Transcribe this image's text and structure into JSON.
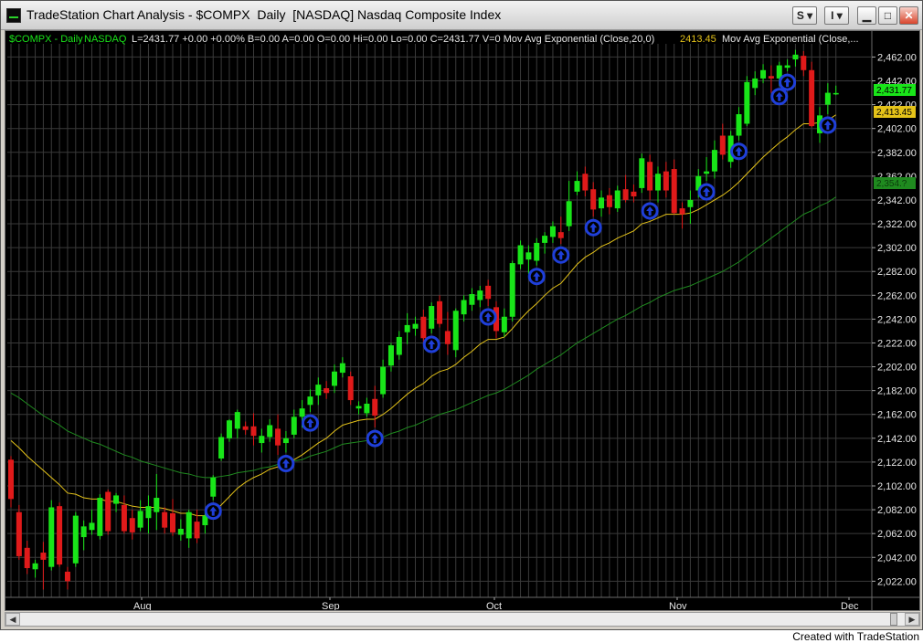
{
  "window": {
    "title": "TradeStation Chart Analysis - $COMPX  Daily  [NASDAQ] Nasdaq Composite Index",
    "buttons": {
      "s_label": "S ▾",
      "i_label": "I ▾",
      "minimize": "▁",
      "maximize": "□",
      "close": "✕"
    }
  },
  "status": {
    "symbol": "$COMPX - Daily",
    "exchange": "NASDAQ",
    "values": "L=2431.77  +0.00  +0.00%  B=0.00  A=0.00  O=0.00  Hi=0.00  Lo=0.00  C=2431.77  V=0  Mov Avg Exponential  (Close,20,0)",
    "ema20_value": "2413.45",
    "ema2_label": "Mov Avg Exponential  (Close,..."
  },
  "price_badges": {
    "last": "2,431.77",
    "ema20": "2,413.45",
    "ema50": "2,354.?"
  },
  "colors": {
    "up": "#19e519",
    "down": "#e01a1a",
    "ema20": "#e5c319",
    "ema50": "#1f8a1f",
    "signal": "#1f3fd9",
    "grid": "#3a3a3a",
    "background": "#000000"
  },
  "credit": "Created with TradeStation",
  "chart_data": {
    "type": "candlestick",
    "title": "$COMPX - Daily",
    "y_axis": {
      "min": 2010,
      "max": 2470,
      "ticks": [
        "2,022.00",
        "2,042.00",
        "2,062.00",
        "2,082.00",
        "2,102.00",
        "2,122.00",
        "2,142.00",
        "2,162.00",
        "2,182.00",
        "2,202.00",
        "2,222.00",
        "2,242.00",
        "2,262.00",
        "2,282.00",
        "2,302.00",
        "2,322.00",
        "2,342.00",
        "2,362.00",
        "2,382.00",
        "2,402.00",
        "2,422.00",
        "2,442.00",
        "2,462.00"
      ]
    },
    "x_axis": {
      "labels": [
        "Aug",
        "Sep",
        "Oct",
        "Nov",
        "Dec"
      ]
    },
    "candles": [
      {
        "o": 2124,
        "h": 2127,
        "l": 2084,
        "c": 2091
      },
      {
        "o": 2080,
        "h": 2086,
        "l": 2040,
        "c": 2043
      },
      {
        "o": 2050,
        "h": 2056,
        "l": 2028,
        "c": 2033
      },
      {
        "o": 2032,
        "h": 2040,
        "l": 2025,
        "c": 2037
      },
      {
        "o": 2046,
        "h": 2055,
        "l": 2015,
        "c": 2040
      },
      {
        "o": 2034,
        "h": 2090,
        "l": 2031,
        "c": 2084
      },
      {
        "o": 2085,
        "h": 2088,
        "l": 2034,
        "c": 2036
      },
      {
        "o": 2030,
        "h": 2034,
        "l": 2015,
        "c": 2022
      },
      {
        "o": 2037,
        "h": 2080,
        "l": 2034,
        "c": 2077
      },
      {
        "o": 2059,
        "h": 2073,
        "l": 2048,
        "c": 2068
      },
      {
        "o": 2065,
        "h": 2082,
        "l": 2061,
        "c": 2071
      },
      {
        "o": 2060,
        "h": 2095,
        "l": 2057,
        "c": 2092
      },
      {
        "o": 2097,
        "h": 2099,
        "l": 2061,
        "c": 2064
      },
      {
        "o": 2087,
        "h": 2096,
        "l": 2080,
        "c": 2094
      },
      {
        "o": 2086,
        "h": 2094,
        "l": 2062,
        "c": 2064
      },
      {
        "o": 2075,
        "h": 2082,
        "l": 2057,
        "c": 2063
      },
      {
        "o": 2067,
        "h": 2090,
        "l": 2064,
        "c": 2081
      },
      {
        "o": 2075,
        "h": 2094,
        "l": 2062,
        "c": 2085
      },
      {
        "o": 2080,
        "h": 2112,
        "l": 2065,
        "c": 2092
      },
      {
        "o": 2080,
        "h": 2084,
        "l": 2062,
        "c": 2067
      },
      {
        "o": 2079,
        "h": 2091,
        "l": 2060,
        "c": 2063
      },
      {
        "o": 2061,
        "h": 2074,
        "l": 2056,
        "c": 2066
      },
      {
        "o": 2058,
        "h": 2082,
        "l": 2050,
        "c": 2080
      },
      {
        "o": 2072,
        "h": 2082,
        "l": 2054,
        "c": 2058
      },
      {
        "o": 2069,
        "h": 2081,
        "l": 2062,
        "c": 2077
      },
      {
        "o": 2093,
        "h": 2111,
        "l": 2090,
        "c": 2109
      },
      {
        "o": 2125,
        "h": 2146,
        "l": 2123,
        "c": 2143
      },
      {
        "o": 2142,
        "h": 2158,
        "l": 2139,
        "c": 2157
      },
      {
        "o": 2150,
        "h": 2166,
        "l": 2142,
        "c": 2164
      },
      {
        "o": 2152,
        "h": 2156,
        "l": 2145,
        "c": 2149
      },
      {
        "o": 2152,
        "h": 2163,
        "l": 2136,
        "c": 2144
      },
      {
        "o": 2138,
        "h": 2150,
        "l": 2130,
        "c": 2144
      },
      {
        "o": 2143,
        "h": 2158,
        "l": 2139,
        "c": 2153
      },
      {
        "o": 2150,
        "h": 2162,
        "l": 2128,
        "c": 2136
      },
      {
        "o": 2138,
        "h": 2148,
        "l": 2130,
        "c": 2142
      },
      {
        "o": 2145,
        "h": 2166,
        "l": 2142,
        "c": 2160
      },
      {
        "o": 2160,
        "h": 2174,
        "l": 2151,
        "c": 2167
      },
      {
        "o": 2170,
        "h": 2183,
        "l": 2164,
        "c": 2177
      },
      {
        "o": 2178,
        "h": 2193,
        "l": 2170,
        "c": 2187
      },
      {
        "o": 2184,
        "h": 2190,
        "l": 2175,
        "c": 2180
      },
      {
        "o": 2186,
        "h": 2204,
        "l": 2180,
        "c": 2198
      },
      {
        "o": 2197,
        "h": 2210,
        "l": 2193,
        "c": 2205
      },
      {
        "o": 2194,
        "h": 2198,
        "l": 2170,
        "c": 2174
      },
      {
        "o": 2167,
        "h": 2173,
        "l": 2162,
        "c": 2169
      },
      {
        "o": 2163,
        "h": 2176,
        "l": 2160,
        "c": 2171
      },
      {
        "o": 2175,
        "h": 2186,
        "l": 2151,
        "c": 2161
      },
      {
        "o": 2179,
        "h": 2208,
        "l": 2176,
        "c": 2202
      },
      {
        "o": 2203,
        "h": 2222,
        "l": 2198,
        "c": 2220
      },
      {
        "o": 2212,
        "h": 2232,
        "l": 2208,
        "c": 2227
      },
      {
        "o": 2231,
        "h": 2247,
        "l": 2221,
        "c": 2237
      },
      {
        "o": 2234,
        "h": 2244,
        "l": 2228,
        "c": 2238
      },
      {
        "o": 2244,
        "h": 2250,
        "l": 2222,
        "c": 2226
      },
      {
        "o": 2234,
        "h": 2256,
        "l": 2230,
        "c": 2253
      },
      {
        "o": 2257,
        "h": 2262,
        "l": 2235,
        "c": 2238
      },
      {
        "o": 2232,
        "h": 2248,
        "l": 2212,
        "c": 2221
      },
      {
        "o": 2216,
        "h": 2251,
        "l": 2210,
        "c": 2249
      },
      {
        "o": 2246,
        "h": 2262,
        "l": 2240,
        "c": 2258
      },
      {
        "o": 2254,
        "h": 2268,
        "l": 2249,
        "c": 2263
      },
      {
        "o": 2258,
        "h": 2270,
        "l": 2252,
        "c": 2266
      },
      {
        "o": 2270,
        "h": 2275,
        "l": 2253,
        "c": 2259
      },
      {
        "o": 2252,
        "h": 2257,
        "l": 2226,
        "c": 2232
      },
      {
        "o": 2231,
        "h": 2251,
        "l": 2227,
        "c": 2244
      },
      {
        "o": 2244,
        "h": 2291,
        "l": 2240,
        "c": 2289
      },
      {
        "o": 2288,
        "h": 2308,
        "l": 2284,
        "c": 2304
      },
      {
        "o": 2292,
        "h": 2304,
        "l": 2280,
        "c": 2298
      },
      {
        "o": 2291,
        "h": 2310,
        "l": 2287,
        "c": 2306
      },
      {
        "o": 2306,
        "h": 2315,
        "l": 2297,
        "c": 2312
      },
      {
        "o": 2311,
        "h": 2324,
        "l": 2306,
        "c": 2320
      },
      {
        "o": 2315,
        "h": 2328,
        "l": 2305,
        "c": 2310
      },
      {
        "o": 2320,
        "h": 2358,
        "l": 2316,
        "c": 2341
      },
      {
        "o": 2349,
        "h": 2366,
        "l": 2346,
        "c": 2358
      },
      {
        "o": 2364,
        "h": 2370,
        "l": 2345,
        "c": 2350
      },
      {
        "o": 2351,
        "h": 2357,
        "l": 2328,
        "c": 2334
      },
      {
        "o": 2335,
        "h": 2350,
        "l": 2328,
        "c": 2344
      },
      {
        "o": 2346,
        "h": 2352,
        "l": 2330,
        "c": 2336
      },
      {
        "o": 2335,
        "h": 2354,
        "l": 2332,
        "c": 2350
      },
      {
        "o": 2351,
        "h": 2363,
        "l": 2340,
        "c": 2342
      },
      {
        "o": 2349,
        "h": 2355,
        "l": 2340,
        "c": 2345
      },
      {
        "o": 2352,
        "h": 2381,
        "l": 2348,
        "c": 2377
      },
      {
        "o": 2374,
        "h": 2380,
        "l": 2342,
        "c": 2350
      },
      {
        "o": 2350,
        "h": 2370,
        "l": 2340,
        "c": 2364
      },
      {
        "o": 2366,
        "h": 2374,
        "l": 2344,
        "c": 2350
      },
      {
        "o": 2368,
        "h": 2376,
        "l": 2330,
        "c": 2331
      },
      {
        "o": 2335,
        "h": 2340,
        "l": 2318,
        "c": 2330
      },
      {
        "o": 2336,
        "h": 2350,
        "l": 2322,
        "c": 2342
      },
      {
        "o": 2350,
        "h": 2368,
        "l": 2344,
        "c": 2362
      },
      {
        "o": 2364,
        "h": 2378,
        "l": 2358,
        "c": 2366
      },
      {
        "o": 2366,
        "h": 2392,
        "l": 2360,
        "c": 2384
      },
      {
        "o": 2396,
        "h": 2406,
        "l": 2376,
        "c": 2380
      },
      {
        "o": 2374,
        "h": 2400,
        "l": 2369,
        "c": 2396
      },
      {
        "o": 2396,
        "h": 2420,
        "l": 2392,
        "c": 2414
      },
      {
        "o": 2406,
        "h": 2446,
        "l": 2404,
        "c": 2441
      },
      {
        "o": 2436,
        "h": 2450,
        "l": 2430,
        "c": 2444
      },
      {
        "o": 2444,
        "h": 2456,
        "l": 2440,
        "c": 2451
      },
      {
        "o": 2446,
        "h": 2455,
        "l": 2432,
        "c": 2444
      },
      {
        "o": 2444,
        "h": 2458,
        "l": 2438,
        "c": 2455
      },
      {
        "o": 2453,
        "h": 2460,
        "l": 2450,
        "c": 2455
      },
      {
        "o": 2460,
        "h": 2468,
        "l": 2454,
        "c": 2464
      },
      {
        "o": 2463,
        "h": 2467,
        "l": 2446,
        "c": 2451
      },
      {
        "o": 2451,
        "h": 2458,
        "l": 2403,
        "c": 2404
      },
      {
        "o": 2398,
        "h": 2420,
        "l": 2390,
        "c": 2413
      },
      {
        "o": 2422,
        "h": 2440,
        "l": 2414,
        "c": 2432
      },
      {
        "o": 2431.77,
        "h": 2438,
        "l": 2430,
        "c": 2431.77
      }
    ],
    "ema20": [
      2140,
      2134,
      2127,
      2121,
      2115,
      2109,
      2103,
      2096,
      2095,
      2092,
      2091,
      2091,
      2089,
      2089,
      2087,
      2085,
      2084,
      2084,
      2084,
      2083,
      2081,
      2079,
      2079,
      2077,
      2077,
      2080,
      2086,
      2093,
      2100,
      2105,
      2109,
      2112,
      2116,
      2118,
      2120,
      2124,
      2128,
      2133,
      2138,
      2142,
      2148,
      2153,
      2155,
      2157,
      2158,
      2158,
      2162,
      2167,
      2173,
      2179,
      2184,
      2188,
      2194,
      2198,
      2200,
      2204,
      2210,
      2215,
      2221,
      2225,
      2225,
      2227,
      2234,
      2242,
      2249,
      2255,
      2262,
      2268,
      2272,
      2280,
      2288,
      2294,
      2298,
      2303,
      2306,
      2310,
      2313,
      2316,
      2322,
      2324,
      2327,
      2330,
      2330,
      2330,
      2331,
      2334,
      2338,
      2342,
      2346,
      2351,
      2357,
      2364,
      2371,
      2378,
      2384,
      2390,
      2395,
      2401,
      2406,
      2406,
      2407,
      2409,
      2413.45
    ],
    "ema50": [
      2180,
      2176,
      2171,
      2166,
      2161,
      2157,
      2153,
      2148,
      2145,
      2142,
      2139,
      2137,
      2134,
      2131,
      2128,
      2126,
      2123,
      2121,
      2119,
      2117,
      2115,
      2113,
      2112,
      2110,
      2109,
      2109,
      2110,
      2111,
      2113,
      2114,
      2115,
      2117,
      2118,
      2120,
      2121,
      2123,
      2124,
      2127,
      2129,
      2131,
      2134,
      2137,
      2138,
      2139,
      2140,
      2141,
      2143,
      2146,
      2148,
      2151,
      2153,
      2156,
      2159,
      2162,
      2164,
      2166,
      2169,
      2172,
      2175,
      2178,
      2180,
      2183,
      2187,
      2191,
      2195,
      2200,
      2204,
      2208,
      2212,
      2217,
      2222,
      2226,
      2230,
      2234,
      2238,
      2242,
      2245,
      2249,
      2253,
      2256,
      2260,
      2263,
      2266,
      2268,
      2270,
      2273,
      2276,
      2279,
      2282,
      2286,
      2290,
      2295,
      2300,
      2305,
      2310,
      2315,
      2320,
      2325,
      2330,
      2333,
      2337,
      2340,
      2344.5
    ],
    "signals": [
      25,
      34,
      37,
      45,
      52,
      59,
      65,
      68,
      72,
      79,
      86,
      90,
      95,
      96,
      101
    ]
  }
}
